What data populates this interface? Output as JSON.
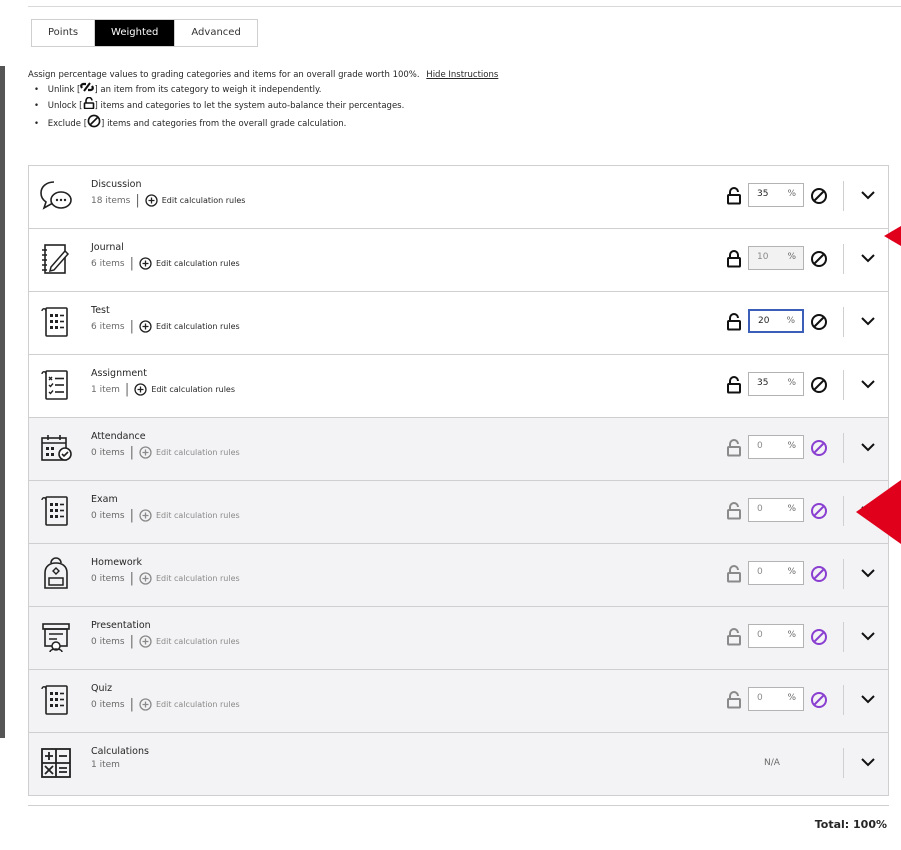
{
  "tabs": [
    {
      "label": "Points",
      "active": false
    },
    {
      "label": "Weighted",
      "active": true
    },
    {
      "label": "Advanced",
      "active": false
    }
  ],
  "instructions": {
    "intro": "Assign percentage values to grading categories and items for an overall grade worth 100%.",
    "hide_link": "Hide Instructions",
    "bullets": [
      {
        "prefix": "Unlink [",
        "icon": "unlink-icon",
        "suffix": "] an item from its category to weigh it independently."
      },
      {
        "prefix": "Unlock [",
        "icon": "unlock-icon",
        "suffix": "] items and categories to let the system auto-balance their percentages."
      },
      {
        "prefix": "Exclude [",
        "icon": "exclude-icon",
        "suffix": "] items and categories from the overall grade calculation."
      }
    ]
  },
  "categories": [
    {
      "name": "Discussion",
      "count": "18 items",
      "edit_label": "Edit calculation rules",
      "percent": "35",
      "locked": false,
      "muted": false,
      "icon": "discussion-icon"
    },
    {
      "name": "Journal",
      "count": "6 items",
      "edit_label": "Edit calculation rules",
      "percent": "10",
      "locked": true,
      "muted": false,
      "icon": "journal-icon"
    },
    {
      "name": "Test",
      "count": "6 items",
      "edit_label": "Edit calculation rules",
      "percent": "20",
      "locked": false,
      "muted": false,
      "focused": true,
      "icon": "test-icon"
    },
    {
      "name": "Assignment",
      "count": "1 item",
      "edit_label": "Edit calculation rules",
      "percent": "35",
      "locked": false,
      "muted": false,
      "icon": "assignment-icon"
    },
    {
      "name": "Attendance",
      "count": "0 items",
      "edit_label": "Edit calculation rules",
      "percent": "0",
      "locked": false,
      "muted": true,
      "icon": "attendance-icon"
    },
    {
      "name": "Exam",
      "count": "0 items",
      "edit_label": "Edit calculation rules",
      "percent": "0",
      "locked": false,
      "muted": true,
      "icon": "exam-icon"
    },
    {
      "name": "Homework",
      "count": "0 items",
      "edit_label": "Edit calculation rules",
      "percent": "0",
      "locked": false,
      "muted": true,
      "icon": "homework-icon"
    },
    {
      "name": "Presentation",
      "count": "0 items",
      "edit_label": "Edit calculation rules",
      "percent": "0",
      "locked": false,
      "muted": true,
      "icon": "presentation-icon"
    },
    {
      "name": "Quiz",
      "count": "0 items",
      "edit_label": "Edit calculation rules",
      "percent": "0",
      "locked": false,
      "muted": true,
      "icon": "quiz-icon"
    }
  ],
  "calculations": {
    "name": "Calculations",
    "count": "1 item",
    "value": "N/A",
    "icon": "calculator-icon"
  },
  "percent_sign": "%",
  "total": "Total: 100%",
  "colors": {
    "accent_purple": "#8a3fd1",
    "focus_blue": "#3b5fb8",
    "annotation_red": "#e0001b"
  }
}
